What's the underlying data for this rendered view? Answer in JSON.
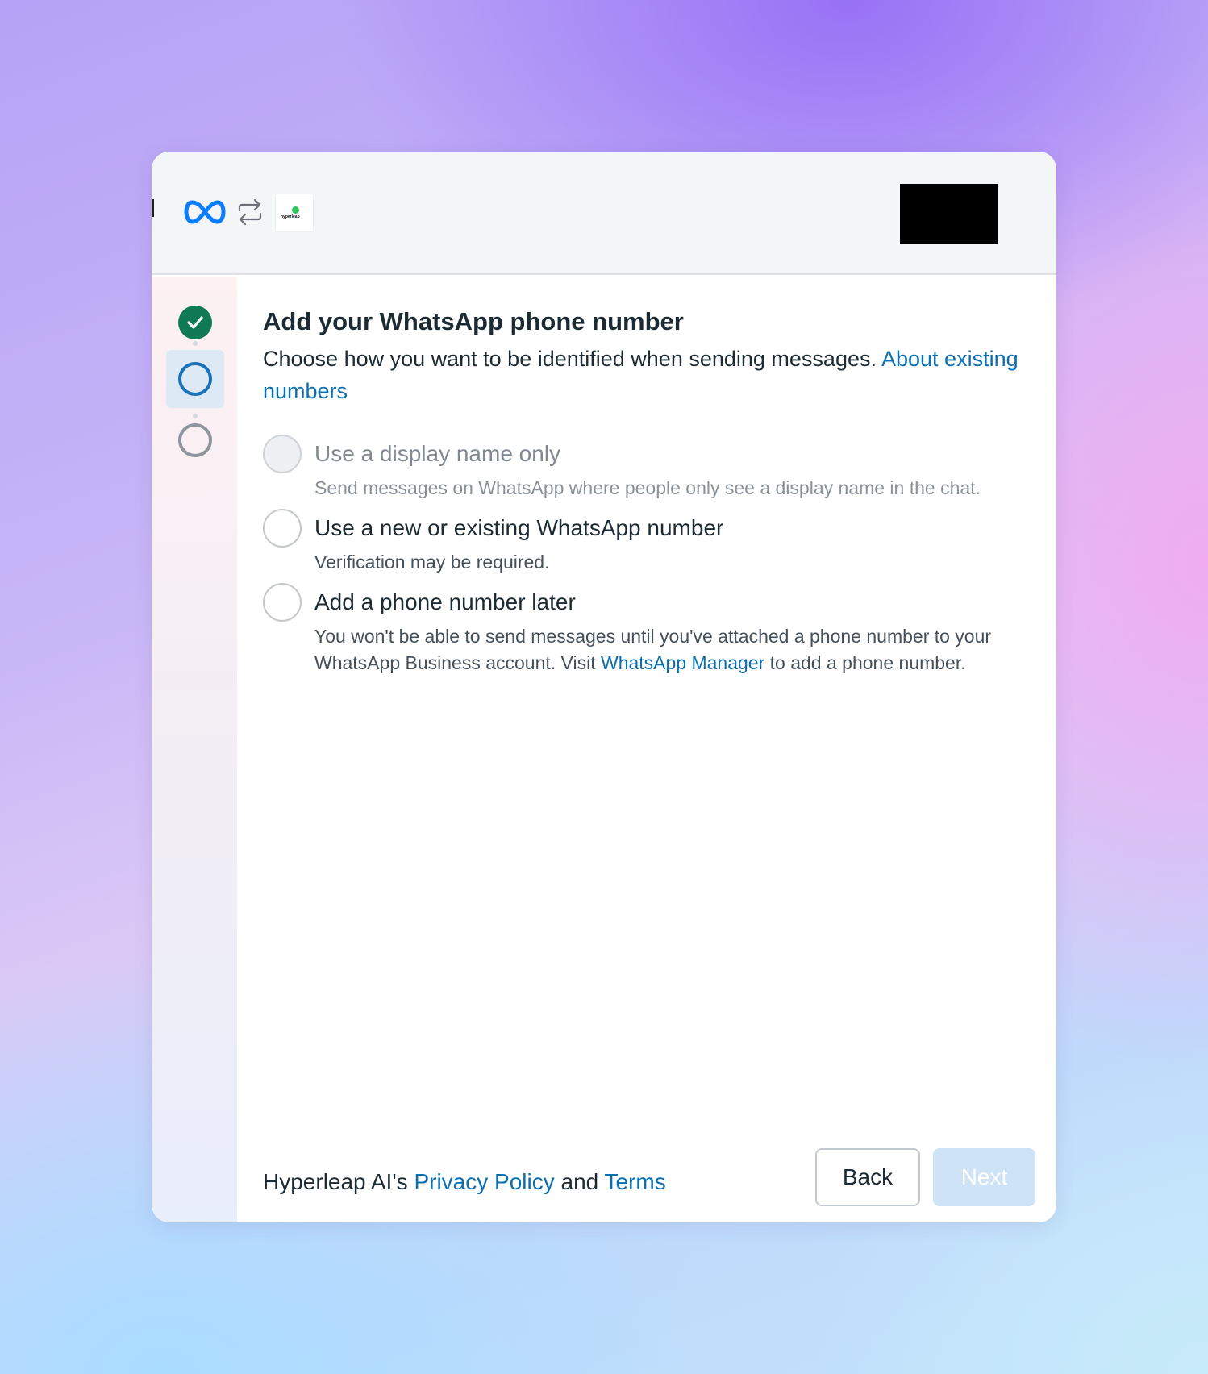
{
  "header": {
    "meta_logo_icon": "meta-infinity-icon",
    "swap_icon": "swap-arrows-icon",
    "brand_logo_text": "hyperleap",
    "colors": {
      "meta_blue": "#0a7cff",
      "brand_green": "#2ec45a"
    }
  },
  "stepper": {
    "steps": [
      {
        "state": "completed",
        "icon": "check-circle-icon"
      },
      {
        "state": "current",
        "icon": "circle-outline-icon"
      },
      {
        "state": "upcoming",
        "icon": "circle-outline-icon"
      }
    ],
    "colors": {
      "done": "#0f7a55",
      "current": "#1a72b8",
      "upcoming": "#8f959c"
    }
  },
  "main": {
    "title": "Add your WhatsApp phone number",
    "subtitle": "Choose how you want to be identified when sending messages.",
    "subtitle_link": "About existing numbers",
    "options": [
      {
        "label": "Use a display name only",
        "description": "Send messages on WhatsApp where people only see a display name in the chat.",
        "disabled": true
      },
      {
        "label": "Use a new or existing WhatsApp number",
        "description": "Verification may be required.",
        "disabled": false
      },
      {
        "label": "Add a phone number later",
        "description_before": "You won't be able to send messages until you've attached a phone number to your WhatsApp Business account. Visit",
        "description_link": "WhatsApp Manager",
        "description_after": "to add a phone number.",
        "disabled": false
      }
    ]
  },
  "footer": {
    "owner": "Hyperleap AI's",
    "privacy_link": "Privacy Policy",
    "and": "and",
    "terms_link": "Terms",
    "back_label": "Back",
    "next_label": "Next"
  }
}
